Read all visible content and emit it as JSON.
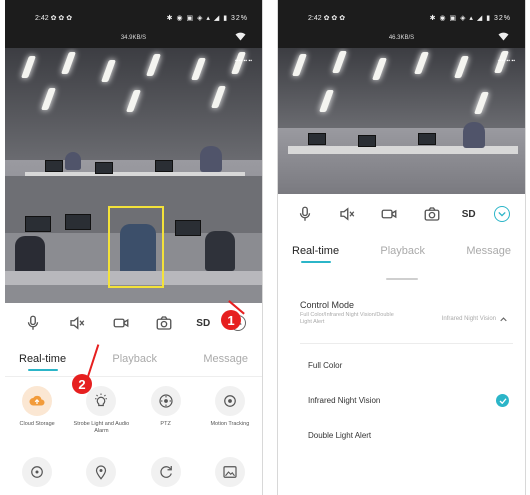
{
  "left_screen": {
    "status": {
      "time": "2:42 ✿ ✿ ✿",
      "icons": "✱ ◉ ▣ ◈ ▴ ◢ ▮ 32%",
      "speed": "34.9KB/S",
      "wifi_icon": "wifi-icon"
    },
    "toolbar": {
      "sd": "SD"
    },
    "tabs": [
      "Real-time",
      "Playback",
      "Message"
    ],
    "features": [
      {
        "label": "Cloud Storage",
        "icon": "cloud-upload-icon"
      },
      {
        "label": "Strobe Light and Audio Alarm",
        "icon": "light-bulb-icon"
      },
      {
        "label": "PTZ",
        "icon": "ptz-icon"
      },
      {
        "label": "Motion Tracking",
        "icon": "motion-tracking-icon"
      },
      {
        "label": "",
        "icon": "target-icon"
      },
      {
        "label": "",
        "icon": "location-icon"
      },
      {
        "label": "",
        "icon": "rotate-icon"
      },
      {
        "label": "",
        "icon": "image-icon"
      }
    ],
    "markers": [
      "1",
      "2"
    ]
  },
  "right_screen": {
    "status": {
      "time": "2:42 ✿ ✿ ✿",
      "icons": "✱ ◉ ▣ ◈ ▴ ◢ ▮ 32%",
      "speed": "46.3KB/S",
      "wifi_icon": "wifi-icon"
    },
    "toolbar": {
      "sd": "SD"
    },
    "tabs": [
      "Real-time",
      "Playback",
      "Message"
    ],
    "control_mode": {
      "title": "Control Mode",
      "description": "Full Color/Infrared Night Vision/Double Light Alert",
      "current": "Infrared Night Vision"
    },
    "options": [
      "Full Color",
      "Infrared Night Vision",
      "Double Light Alert"
    ],
    "selected_index": 1
  },
  "colors": {
    "accent": "#2bb5c8",
    "marker": "#e61f1f",
    "status_bar": "#1c1c1c"
  }
}
